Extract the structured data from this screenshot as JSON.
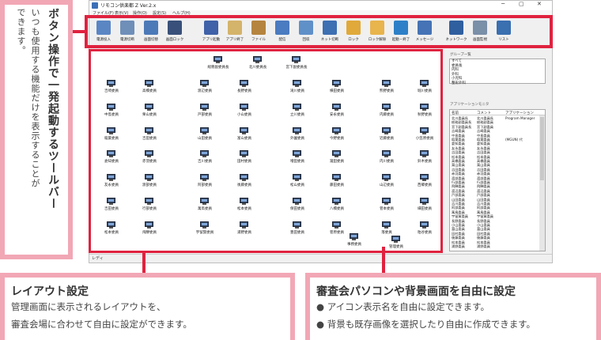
{
  "callouts": {
    "toolbar": {
      "title": "ボタン操作で一発起動するツールバー",
      "lines": [
        "いつも使用する機能だけを表示することが",
        "できます。"
      ]
    },
    "layout": {
      "title": "レイアウト設定",
      "lines": [
        "管理画面に表示されるレイアウトを、",
        "審査会場に合わせて自由に設定ができます。"
      ]
    },
    "background": {
      "title": "審査会パソコンや背景画面を自由に設定",
      "bullets": [
        "● アイコン表示名を自由に設定できます。",
        "● 背景も既存画像を選択したり自由に作成できます。"
      ]
    }
  },
  "window": {
    "title": "リモコン供楽都 Z Ver.2.x",
    "controls": [
      "─",
      "▢",
      "✕"
    ],
    "menu": [
      "ファイル(F)",
      "表示(V)",
      "操作(O)",
      "設定(S)",
      "ヘルプ(H)"
    ],
    "status": "レディ"
  },
  "toolbar": {
    "buttons": [
      {
        "label": "電源投入",
        "icon": "monitor-power-icon",
        "color": "#5b86c4"
      },
      {
        "label": "電源切断",
        "icon": "monitor-off-icon",
        "color": "#6f8fb9"
      },
      {
        "label": "画面切替",
        "icon": "screen-switch-icon",
        "color": "#4c7ab8"
      },
      {
        "label": "画面ロック",
        "icon": "screen-lock-icon",
        "color": "#39517a"
      },
      {
        "label": "アプリ起動",
        "icon": "app-launch-icon",
        "color": "#3f62a8"
      },
      {
        "label": "アプリ終了",
        "icon": "checklist-icon",
        "color": "#d4b36a"
      },
      {
        "label": "ファイル",
        "icon": "file-transfer-icon",
        "color": "#b5843f"
      },
      {
        "label": "配信",
        "icon": "distribute-icon",
        "color": "#4b7bc0"
      },
      {
        "label": "回収",
        "icon": "collect-icon",
        "color": "#6090c8"
      },
      {
        "label": "ネット切断",
        "icon": "network-cut-icon",
        "color": "#3d6fb3"
      },
      {
        "label": "ロック",
        "icon": "lock-icon",
        "color": "#e0a93a"
      },
      {
        "label": "ロック解除",
        "icon": "unlock-icon",
        "color": "#e8b44c"
      },
      {
        "label": "起動・終了",
        "icon": "power-icon",
        "color": "#2d80c8"
      },
      {
        "label": "メッセージ",
        "icon": "message-icon",
        "color": "#4573b5"
      },
      {
        "label": "ネットワーク",
        "icon": "binoculars-icon",
        "color": "#2f5f9f"
      },
      {
        "label": "画面監視",
        "icon": "screen-watch-icon",
        "color": "#7a8fa8"
      },
      {
        "label": "リスト",
        "icon": "list-view-icon",
        "color": "#3a6fb0"
      }
    ]
  },
  "computers": [
    {
      "label": "総務副委員長"
    },
    {
      "label": "北川委員長"
    },
    {
      "label": "宮下副委員長"
    },
    {
      "label": "吉崎委員"
    },
    {
      "label": "高橋委員"
    },
    {
      "label": "渡辺委員"
    },
    {
      "label": "長野委員"
    },
    {
      "label": "滝川委員"
    },
    {
      "label": "横田委員"
    },
    {
      "label": "熊野委員"
    },
    {
      "label": "堀川委員"
    },
    {
      "label": "中島委員"
    },
    {
      "label": "栗山委員"
    },
    {
      "label": "戸部委員"
    },
    {
      "label": "小山委員"
    },
    {
      "label": "立川委員"
    },
    {
      "label": "安永委員"
    },
    {
      "label": "内藤委員"
    },
    {
      "label": "秋野委員"
    },
    {
      "label": "稲葉委員"
    },
    {
      "label": "吉田委員"
    },
    {
      "label": "山田委員"
    },
    {
      "label": "富山委員"
    },
    {
      "label": "外園委員"
    },
    {
      "label": "今野委員"
    },
    {
      "label": "近藤委員"
    },
    {
      "label": "小笠原委員"
    },
    {
      "label": "倉知委員"
    },
    {
      "label": "赤羽委員"
    },
    {
      "label": "吉川委員"
    },
    {
      "label": "田村委員"
    },
    {
      "label": "増田委員"
    },
    {
      "label": "瀧田委員"
    },
    {
      "label": "内川委員"
    },
    {
      "label": "鈴木委員"
    },
    {
      "label": "友永委員"
    },
    {
      "label": "渡部委員"
    },
    {
      "label": "阿部委員"
    },
    {
      "label": "後藤委員"
    },
    {
      "label": "松山委員"
    },
    {
      "label": "藤田委員"
    },
    {
      "label": "山辺委員"
    },
    {
      "label": "西郷委員"
    },
    {
      "label": "吉田委員"
    },
    {
      "label": "行部委員"
    },
    {
      "label": "萬鳥委員"
    },
    {
      "label": "松本委員"
    },
    {
      "label": "保田委員"
    },
    {
      "label": "八橋委員"
    },
    {
      "label": "菅本委員"
    },
    {
      "label": "細田委員"
    },
    {
      "label": "松本委員"
    },
    {
      "label": "飛騨委員"
    },
    {
      "label": "宇留賀委員"
    },
    {
      "label": "浦野委員"
    },
    {
      "label": "豊田委員"
    },
    {
      "label": "菅原委員"
    },
    {
      "label": "落委員"
    },
    {
      "label": "粕谷委員"
    },
    {
      "label": "事務委員"
    },
    {
      "label": "管理委員"
    }
  ],
  "group_panel": {
    "title": "グループ一覧",
    "items": [
      "すべて",
      "委員長",
      "内科",
      "外科",
      "小児科",
      "整形外科"
    ]
  },
  "monitor_panel": {
    "title": "アプリケーションモニタ",
    "columns": [
      "名前",
      "コメント",
      "アプリケーション"
    ],
    "rows": [
      [
        "北川委員長",
        "北川委員長",
        "Program Manager"
      ],
      [
        "総務副委員長",
        "総務副委員",
        ""
      ],
      [
        "宮下副委員長",
        "宮下副委員",
        ""
      ],
      [
        "吉崎委員",
        "吉崎委員",
        ""
      ],
      [
        "中島委員",
        "中島委員",
        ""
      ],
      [
        "稲葉委員",
        "稲葉委員",
        "(MGUN) 代"
      ],
      [
        "倉知委員",
        "倉知委員",
        ""
      ],
      [
        "友永委員",
        "友永委員",
        ""
      ],
      [
        "吉田委員",
        "吉田委員",
        ""
      ],
      [
        "松本委員",
        "松本委員",
        ""
      ],
      [
        "高橋委員",
        "高橋委員",
        ""
      ],
      [
        "栗山委員",
        "栗山委員",
        ""
      ],
      [
        "吉田委員",
        "吉田委員",
        ""
      ],
      [
        "赤羽委員",
        "赤羽委員",
        ""
      ],
      [
        "渡部委員",
        "渡部委員",
        ""
      ],
      [
        "行部委員",
        "行部委員",
        ""
      ],
      [
        "飛騨委員",
        "飛騨委員",
        ""
      ],
      [
        "渡辺委員",
        "渡辺委員",
        ""
      ],
      [
        "戸部委員",
        "戸部委員",
        ""
      ],
      [
        "山田委員",
        "山田委員",
        ""
      ],
      [
        "吉川委員",
        "吉川委員",
        ""
      ],
      [
        "阿部委員",
        "阿部委員",
        ""
      ],
      [
        "萬鳥委員",
        "萬鳥委員",
        ""
      ],
      [
        "宇留賀委員",
        "宇留賀委員",
        ""
      ],
      [
        "長野委員",
        "長野委員",
        ""
      ],
      [
        "小山委員",
        "小山委員",
        ""
      ],
      [
        "富山委員",
        "富山委員",
        ""
      ],
      [
        "田村委員",
        "田村委員",
        ""
      ],
      [
        "後藤委員",
        "後藤委員",
        ""
      ],
      [
        "松本委員",
        "松本委員",
        ""
      ],
      [
        "浦野委員",
        "浦野委員",
        ""
      ]
    ]
  }
}
